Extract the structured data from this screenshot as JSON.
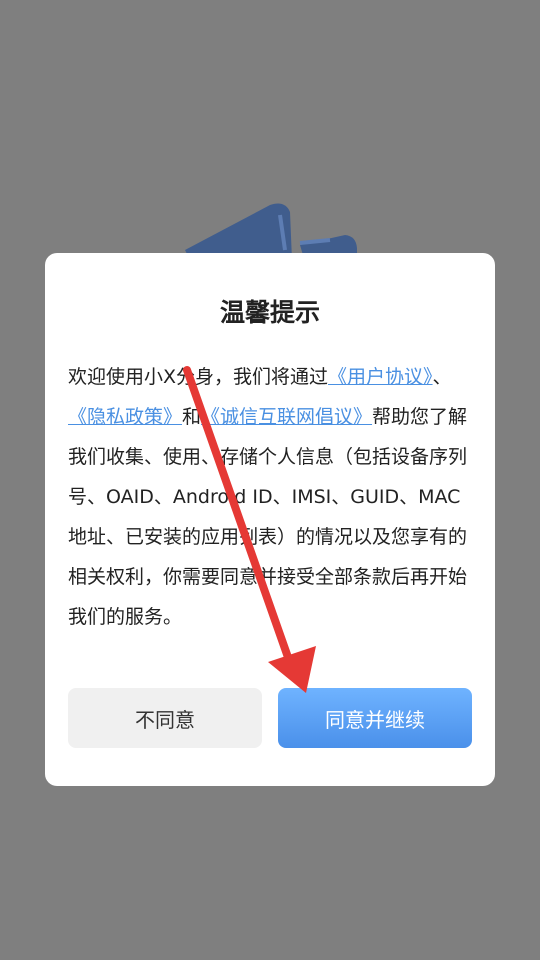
{
  "colors": {
    "overlay": "#7f7f7f",
    "link": "#4a90e2",
    "accent": "#5aa3f5",
    "annotation_arrow": "#e53935"
  },
  "illustration": {
    "icon": "phone-illustration-icon"
  },
  "dialog": {
    "title": "温馨提示",
    "body": {
      "intro": "欢迎使用小X分身，我们将通过",
      "link_user_agreement": "《用户协议》",
      "sep1": "、",
      "link_privacy_policy": "《隐私政策》",
      "sep2": "和",
      "link_integrity_initiative": "《诚信互联网倡议》",
      "rest": "帮助您了解我们收集、使用、存储个人信息（包括设备序列号、OAID、Android ID、IMSI、GUID、MAC地址、已安装的应用列表）的情况以及您享有的相关权利，你需要同意并接受全部条款后再开始我们的服务。"
    },
    "buttons": {
      "disagree": "不同意",
      "agree": "同意并继续"
    }
  },
  "annotation": {
    "icon": "red-arrow-icon"
  }
}
